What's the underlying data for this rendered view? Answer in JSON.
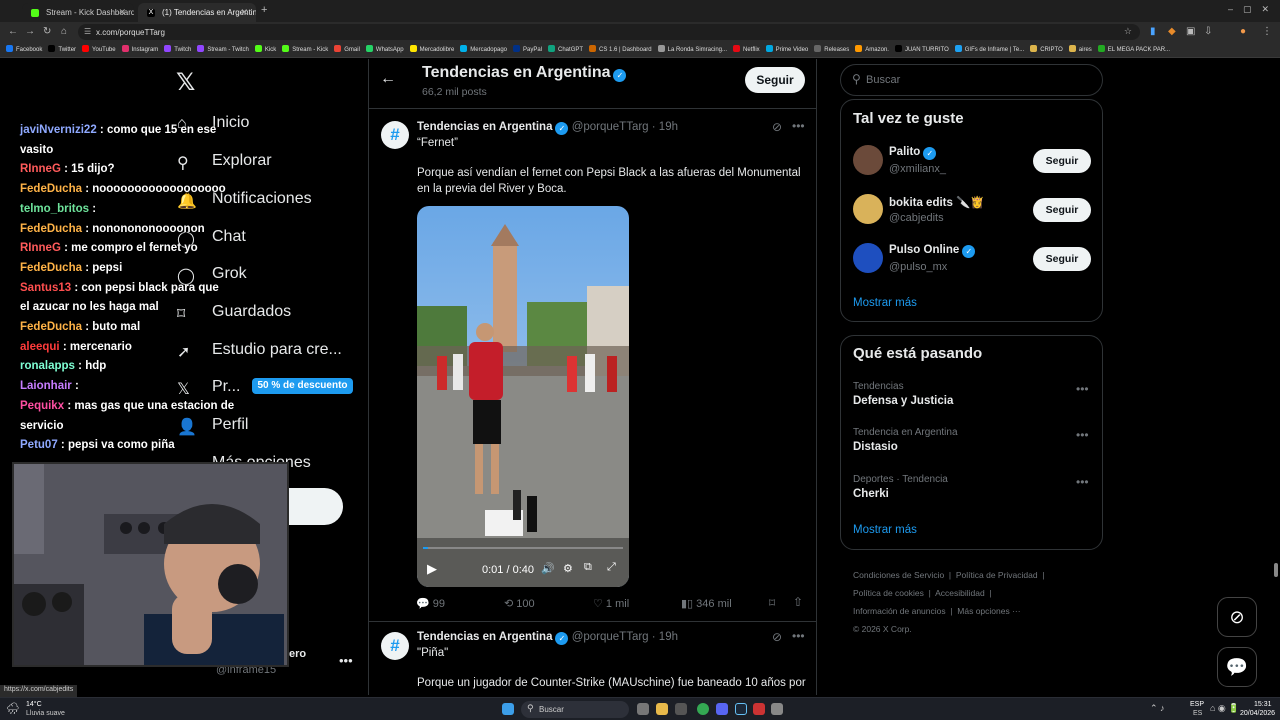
{
  "browser": {
    "tabs": [
      {
        "title": "Stream - Kick Dashboard",
        "active": false
      },
      {
        "title": "(1) Tendencias en Argentin",
        "active": true
      }
    ],
    "url": "x.com/porqueTTarg",
    "bookmarks": [
      "Facebook",
      "Twitter",
      "YouTube",
      "Instagram",
      "Twitch",
      "Stream - Twitch",
      "Kick",
      "Stream - Kick",
      "Gmail",
      "WhatsApp",
      "Mercadolibre",
      "Mercadopago",
      "PayPal",
      "ChatGPT",
      "CS 1.6 | Dashboard",
      "La Ronda Simracing...",
      "Netflix",
      "Prime Video",
      "Releases",
      "Amazon.",
      "JUAN TURRITO",
      "GIFs de Inframe | Te...",
      "CRIPTO",
      "aires",
      "EL MEGA PACK PAR..."
    ],
    "status_url": "https://x.com/cabjedits"
  },
  "chat": [
    {
      "user": "javiNvernizi22",
      "color": "#8fa9ff",
      "text": ": como que 15 en ese"
    },
    {
      "user": "",
      "color": "#ffffff",
      "text": "vasito"
    },
    {
      "user": "RInneG",
      "color": "#ff5b5b",
      "text": ": 15 dijo?"
    },
    {
      "user": "FedeDucha",
      "color": "#ffb347",
      "text": ": noooooooooooooooooo"
    },
    {
      "user": "telmo_britos",
      "color": "#6ee39b",
      "text": ":"
    },
    {
      "user": "FedeDucha",
      "color": "#ffb347",
      "text": ": nononononoooonon"
    },
    {
      "user": "RInneG",
      "color": "#ff5b5b",
      "text": ": me compro el fernet yo"
    },
    {
      "user": "FedeDucha",
      "color": "#ffb347",
      "text": ": pepsi"
    },
    {
      "user": "Santus13",
      "color": "#ff4f4f",
      "text": ": con pepsi black para que"
    },
    {
      "user": "",
      "color": "#ffffff",
      "text": "el azucar no les haga mal"
    },
    {
      "user": "FedeDucha",
      "color": "#ffb347",
      "text": ": buto mal"
    },
    {
      "user": "aleequi",
      "color": "#ff3b3b",
      "text": ": mercenario"
    },
    {
      "user": "ronalapps",
      "color": "#7fffd4",
      "text": ": hdp"
    },
    {
      "user": "Laionhair",
      "color": "#c77dff",
      "text": ":"
    },
    {
      "user": "Pequikx",
      "color": "#ff4fa3",
      "text": ": mas gas que una estacion de"
    },
    {
      "user": "",
      "color": "#ffffff",
      "text": "servicio"
    },
    {
      "user": "Petu07",
      "color": "#8fa9ff",
      "text": ": pepsi va como piña"
    }
  ],
  "nav": {
    "items": [
      {
        "label": "Inicio",
        "icon": "home-icon",
        "glyph": "⌂"
      },
      {
        "label": "Explorar",
        "icon": "search-icon",
        "glyph": "⚲"
      },
      {
        "label": "Notificaciones",
        "icon": "bell-icon",
        "glyph": "🔔"
      },
      {
        "label": "Chat",
        "icon": "chat-icon",
        "glyph": "◯"
      },
      {
        "label": "Grok",
        "icon": "grok-icon",
        "glyph": "◯"
      },
      {
        "label": "Guardados",
        "icon": "bookmark-icon",
        "glyph": "⌑"
      },
      {
        "label": "Estudio para cre...",
        "icon": "rocket-icon",
        "glyph": "➚"
      },
      {
        "label": "Pr...",
        "icon": "x-premium-icon",
        "glyph": "𝕏"
      },
      {
        "label": "Perfil",
        "icon": "profile-icon",
        "glyph": "👤"
      },
      {
        "label": "Más opciones",
        "icon": "more-icon",
        "glyph": "⋯"
      }
    ],
    "premium_badge": "50 % de descuento",
    "account_handle": "@inframe15",
    "account_name_tail": "ero"
  },
  "header": {
    "title": "Tendencias en Argentina",
    "post_count": "66,2 mil posts",
    "follow_label": "Seguir"
  },
  "posts": [
    {
      "author": "Tendencias en Argentina",
      "handle": "@porqueTTarg",
      "time": "· 19h",
      "title": "“Fernet”",
      "body": "Porque así vendían el fernet con Pepsi Black a las afueras del Monumental en la previa del River y Boca.",
      "video_time": "0:01 / 0:40",
      "video_progress": 0.025,
      "stats": {
        "replies": "99",
        "reposts": "100",
        "likes": "1 mil",
        "views": "346 mil"
      }
    },
    {
      "author": "Tendencias en Argentina",
      "handle": "@porqueTTarg",
      "time": "· 19h",
      "title": "\"Piña\"",
      "body": "Porque un jugador de Counter-Strike (MAUschine) fue baneado 10 años por"
    }
  ],
  "right": {
    "search_placeholder": "Buscar",
    "suggest_title": "Tal vez te guste",
    "suggestions": [
      {
        "name": "Palito",
        "handle": "@xmilianx_",
        "verified": true,
        "follow": "Seguir",
        "avatar_color": "#6b4a3a"
      },
      {
        "name": "bokita edits 🔪👸",
        "handle": "@cabjedits",
        "verified": false,
        "follow": "Seguir",
        "avatar_color": "#d9b25a"
      },
      {
        "name": "Pulso Online",
        "handle": "@pulso_mx",
        "verified": true,
        "follow": "Seguir",
        "avatar_color": "#1e4fbf"
      }
    ],
    "show_more": "Mostrar más",
    "trends_title": "Qué está pasando",
    "trends": [
      {
        "category": "Tendencias",
        "name": "Defensa y Justicia"
      },
      {
        "category": "Tendencia en Argentina",
        "name": "Distasio"
      },
      {
        "category": "Deportes · Tendencia",
        "name": "Cherki"
      }
    ],
    "footer": [
      "Condiciones de Servicio",
      "Política de Privacidad",
      "Política de cookies",
      "Accesibilidad",
      "Información de anuncios",
      "Más opciones ···",
      "© 2026 X Corp."
    ]
  },
  "taskbar": {
    "weather_temp": "14°C",
    "weather_desc": "Lluvia suave",
    "search": "Buscar",
    "lang": "ESP",
    "lang2": "ES",
    "time": "15:31",
    "date": "20/04/2026"
  }
}
